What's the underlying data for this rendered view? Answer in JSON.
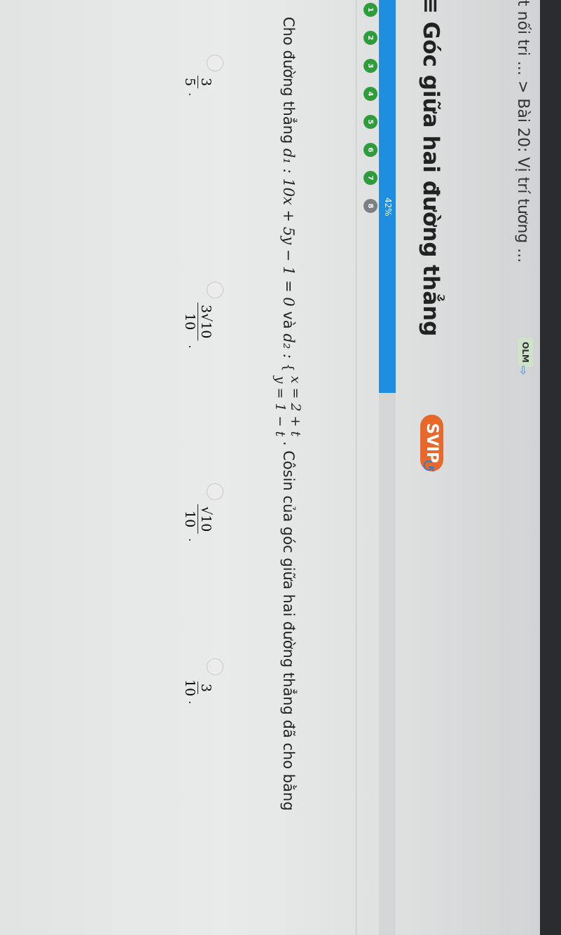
{
  "breadcrumb": {
    "prev": "t nối tri ...",
    "separator": ">",
    "current": "Bài 20: Vị trí tương ...",
    "badge": "OLM"
  },
  "title": "Góc giữa hai đường thẳng",
  "svip": "SVIP",
  "progress": {
    "percent": 42,
    "label": "42%"
  },
  "steps": [
    {
      "n": "1",
      "done": true
    },
    {
      "n": "2",
      "done": true
    },
    {
      "n": "3",
      "done": true
    },
    {
      "n": "4",
      "done": true
    },
    {
      "n": "5",
      "done": true
    },
    {
      "n": "6",
      "done": true
    },
    {
      "n": "7",
      "done": true
    },
    {
      "n": "8",
      "done": false
    }
  ],
  "question": {
    "p1": "Cho đường thẳng ",
    "d1": "d₁ : 10x + 5y − 1 = 0",
    "p2": " và ",
    "d2": "d₂ : ",
    "sys1": "x = 2 + t",
    "sys2": "y = 1 − t",
    "p3": " . Côsin của góc giữa hai đường thẳng đã cho bằng"
  },
  "options": [
    {
      "num": "3",
      "den": "5"
    },
    {
      "num": "3√10",
      "den": "10"
    },
    {
      "num": "√10",
      "den": "10"
    },
    {
      "num": "3",
      "den": "10"
    }
  ]
}
